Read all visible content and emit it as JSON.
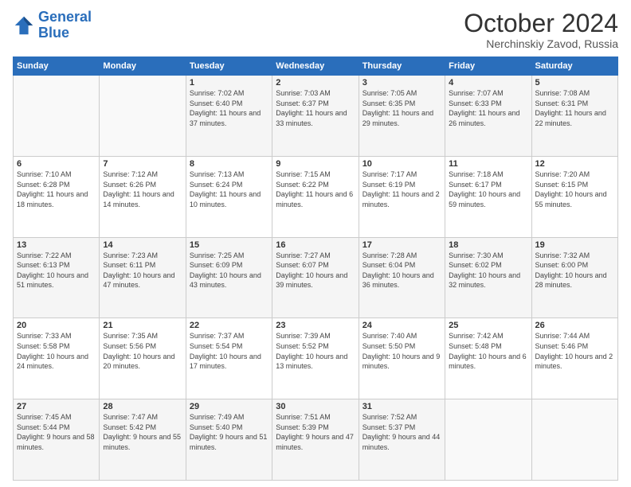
{
  "logo": {
    "line1": "General",
    "line2": "Blue"
  },
  "title": "October 2024",
  "subtitle": "Nerchinskiy Zavod, Russia",
  "days_of_week": [
    "Sunday",
    "Monday",
    "Tuesday",
    "Wednesday",
    "Thursday",
    "Friday",
    "Saturday"
  ],
  "weeks": [
    [
      {
        "day": "",
        "content": ""
      },
      {
        "day": "",
        "content": ""
      },
      {
        "day": "1",
        "content": "Sunrise: 7:02 AM\nSunset: 6:40 PM\nDaylight: 11 hours and 37 minutes."
      },
      {
        "day": "2",
        "content": "Sunrise: 7:03 AM\nSunset: 6:37 PM\nDaylight: 11 hours and 33 minutes."
      },
      {
        "day": "3",
        "content": "Sunrise: 7:05 AM\nSunset: 6:35 PM\nDaylight: 11 hours and 29 minutes."
      },
      {
        "day": "4",
        "content": "Sunrise: 7:07 AM\nSunset: 6:33 PM\nDaylight: 11 hours and 26 minutes."
      },
      {
        "day": "5",
        "content": "Sunrise: 7:08 AM\nSunset: 6:31 PM\nDaylight: 11 hours and 22 minutes."
      }
    ],
    [
      {
        "day": "6",
        "content": "Sunrise: 7:10 AM\nSunset: 6:28 PM\nDaylight: 11 hours and 18 minutes."
      },
      {
        "day": "7",
        "content": "Sunrise: 7:12 AM\nSunset: 6:26 PM\nDaylight: 11 hours and 14 minutes."
      },
      {
        "day": "8",
        "content": "Sunrise: 7:13 AM\nSunset: 6:24 PM\nDaylight: 11 hours and 10 minutes."
      },
      {
        "day": "9",
        "content": "Sunrise: 7:15 AM\nSunset: 6:22 PM\nDaylight: 11 hours and 6 minutes."
      },
      {
        "day": "10",
        "content": "Sunrise: 7:17 AM\nSunset: 6:19 PM\nDaylight: 11 hours and 2 minutes."
      },
      {
        "day": "11",
        "content": "Sunrise: 7:18 AM\nSunset: 6:17 PM\nDaylight: 10 hours and 59 minutes."
      },
      {
        "day": "12",
        "content": "Sunrise: 7:20 AM\nSunset: 6:15 PM\nDaylight: 10 hours and 55 minutes."
      }
    ],
    [
      {
        "day": "13",
        "content": "Sunrise: 7:22 AM\nSunset: 6:13 PM\nDaylight: 10 hours and 51 minutes."
      },
      {
        "day": "14",
        "content": "Sunrise: 7:23 AM\nSunset: 6:11 PM\nDaylight: 10 hours and 47 minutes."
      },
      {
        "day": "15",
        "content": "Sunrise: 7:25 AM\nSunset: 6:09 PM\nDaylight: 10 hours and 43 minutes."
      },
      {
        "day": "16",
        "content": "Sunrise: 7:27 AM\nSunset: 6:07 PM\nDaylight: 10 hours and 39 minutes."
      },
      {
        "day": "17",
        "content": "Sunrise: 7:28 AM\nSunset: 6:04 PM\nDaylight: 10 hours and 36 minutes."
      },
      {
        "day": "18",
        "content": "Sunrise: 7:30 AM\nSunset: 6:02 PM\nDaylight: 10 hours and 32 minutes."
      },
      {
        "day": "19",
        "content": "Sunrise: 7:32 AM\nSunset: 6:00 PM\nDaylight: 10 hours and 28 minutes."
      }
    ],
    [
      {
        "day": "20",
        "content": "Sunrise: 7:33 AM\nSunset: 5:58 PM\nDaylight: 10 hours and 24 minutes."
      },
      {
        "day": "21",
        "content": "Sunrise: 7:35 AM\nSunset: 5:56 PM\nDaylight: 10 hours and 20 minutes."
      },
      {
        "day": "22",
        "content": "Sunrise: 7:37 AM\nSunset: 5:54 PM\nDaylight: 10 hours and 17 minutes."
      },
      {
        "day": "23",
        "content": "Sunrise: 7:39 AM\nSunset: 5:52 PM\nDaylight: 10 hours and 13 minutes."
      },
      {
        "day": "24",
        "content": "Sunrise: 7:40 AM\nSunset: 5:50 PM\nDaylight: 10 hours and 9 minutes."
      },
      {
        "day": "25",
        "content": "Sunrise: 7:42 AM\nSunset: 5:48 PM\nDaylight: 10 hours and 6 minutes."
      },
      {
        "day": "26",
        "content": "Sunrise: 7:44 AM\nSunset: 5:46 PM\nDaylight: 10 hours and 2 minutes."
      }
    ],
    [
      {
        "day": "27",
        "content": "Sunrise: 7:45 AM\nSunset: 5:44 PM\nDaylight: 9 hours and 58 minutes."
      },
      {
        "day": "28",
        "content": "Sunrise: 7:47 AM\nSunset: 5:42 PM\nDaylight: 9 hours and 55 minutes."
      },
      {
        "day": "29",
        "content": "Sunrise: 7:49 AM\nSunset: 5:40 PM\nDaylight: 9 hours and 51 minutes."
      },
      {
        "day": "30",
        "content": "Sunrise: 7:51 AM\nSunset: 5:39 PM\nDaylight: 9 hours and 47 minutes."
      },
      {
        "day": "31",
        "content": "Sunrise: 7:52 AM\nSunset: 5:37 PM\nDaylight: 9 hours and 44 minutes."
      },
      {
        "day": "",
        "content": ""
      },
      {
        "day": "",
        "content": ""
      }
    ]
  ]
}
